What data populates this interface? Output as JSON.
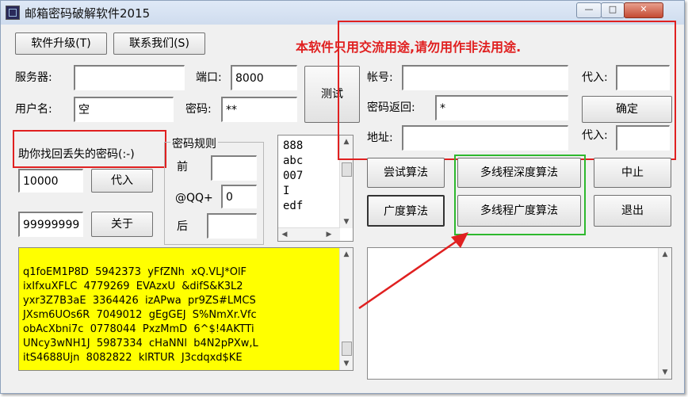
{
  "window": {
    "title": "邮箱密码破解软件2015",
    "minimize": "—",
    "maximize": "□",
    "close": "✕"
  },
  "toolbar": {
    "upgrade": "软件升级(T)",
    "contact": "联系我们(S)"
  },
  "warning": "本软件只用交流用途,请勿用作非法用途.",
  "server": {
    "server_label": "服务器:",
    "server_value": "",
    "port_label": "端口:",
    "port_value": "8000",
    "user_label": "用户名:",
    "user_value": "空",
    "pwd_label": "密码:",
    "pwd_value": "**",
    "test_button": "测试"
  },
  "highlight_label": "助你找回丢失的密码(:-)",
  "range": {
    "start_value": "10000",
    "substitute_button": "代入",
    "end_value": "99999999",
    "about_button": "关于"
  },
  "rules": {
    "title": "密码规则",
    "prefix_label": "前",
    "prefix_value": "",
    "qq_label": "@QQ+",
    "qq_value": "0",
    "suffix_label": "后",
    "suffix_value": ""
  },
  "wordlist": [
    "888",
    "abc",
    "007",
    "I",
    "edf"
  ],
  "results": [
    "q1foEM1P8D  5942373  yFfZNh  xQ.VLJ*OlF",
    "ixIfxuXFLC  4779269  EVAzxU  &difS&K3L2",
    "yxr3Z7B3aE  3364426  izAPwa  pr9ZS#LMCS",
    "JXsm6UOs6R  7049012  gEgGEJ  S%NmXr.Vfc",
    "obAcXbni7c  0778044  PxzMmD  6^$!4AKTTi",
    "UNcy3wNH1J  5987334  cHaNNl  b4N2pPXw,L",
    "itS4688Ujn  8082822  klRTUR  J3cdqxd$KE"
  ],
  "account": {
    "account_label": "帐号:",
    "account_value": "",
    "sub1": "代入:",
    "sub1_value": "",
    "pwd_return_label": "密码返回:",
    "pwd_return_value": "*",
    "confirm_button": "确定",
    "address_label": "地址:",
    "address_value": "",
    "sub2": "代入:",
    "sub2_value": ""
  },
  "algo": {
    "try": "尝试算法",
    "multi_depth": "多线程深度算法",
    "stop": "中止",
    "breadth": "广度算法",
    "multi_breadth": "多线程广度算法",
    "exit": "退出"
  },
  "log_text": "",
  "colors": {
    "accent_red": "#e02020",
    "highlight_yellow": "#ffff00",
    "accent_green": "#2eb82e"
  }
}
